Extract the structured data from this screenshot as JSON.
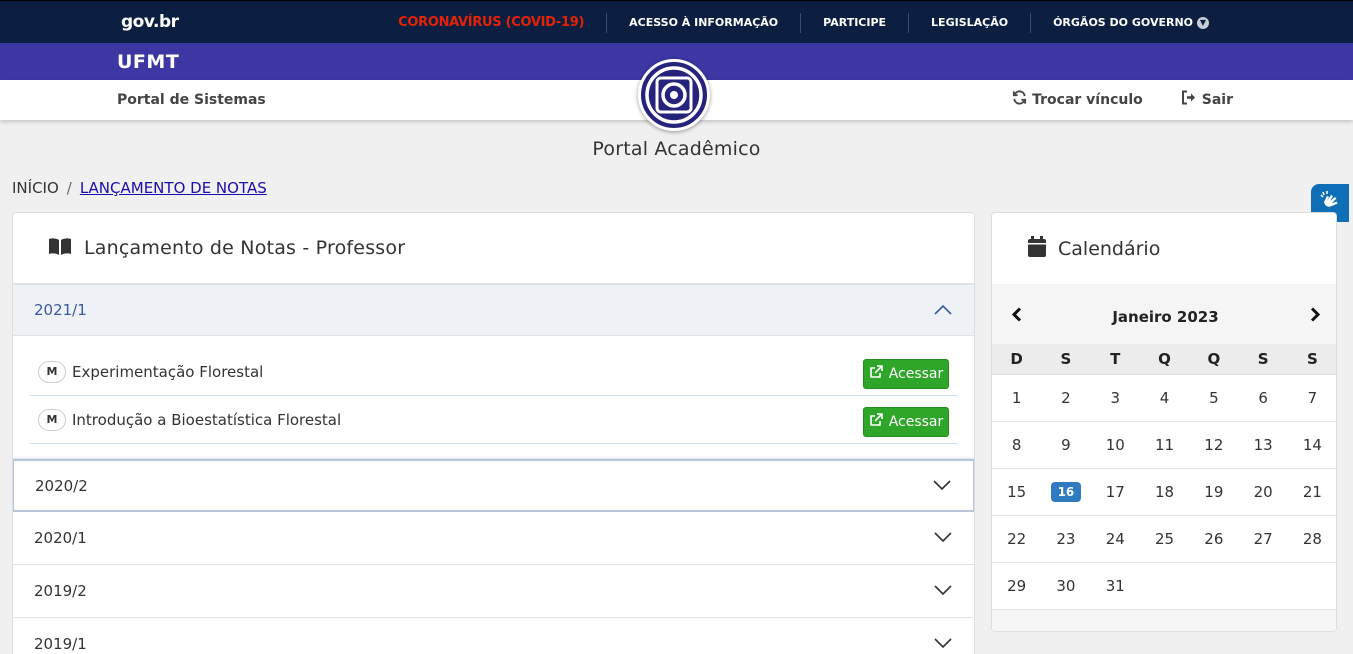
{
  "govbar": {
    "logo": "gov.br",
    "links": [
      {
        "label": "CORONAVÍRUS (COVID-19)"
      },
      {
        "label": "ACESSO À INFORMAÇÃO"
      },
      {
        "label": "PARTICIPE"
      },
      {
        "label": "LEGISLAÇÃO"
      },
      {
        "label": "ÓRGÃOS DO GOVERNO"
      }
    ]
  },
  "ufmtbar": {
    "title": "UFMT"
  },
  "sysbar": {
    "portal_sistemas": "Portal de Sistemas",
    "trocar_vinculo": "Trocar vínculo",
    "sair": "Sair"
  },
  "page_title": "Portal Acadêmico",
  "breadcrumb": {
    "home": "INÍCIO",
    "separator": "/",
    "current": "LANÇAMENTO DE NOTAS"
  },
  "main_card": {
    "title": "Lançamento de Notas - Professor",
    "periods": [
      {
        "label": "2021/1",
        "expanded": true,
        "courses": [
          {
            "badge": "M",
            "name": "Experimentação Florestal",
            "button": "Acessar"
          },
          {
            "badge": "M",
            "name": "Introdução a Bioestatística Florestal",
            "button": "Acessar"
          }
        ]
      },
      {
        "label": "2020/2",
        "expanded": false
      },
      {
        "label": "2020/1",
        "expanded": false
      },
      {
        "label": "2019/2",
        "expanded": false
      },
      {
        "label": "2019/1",
        "expanded": false
      }
    ]
  },
  "calendar": {
    "title": "Calendário",
    "month": "Janeiro 2023",
    "weekdays": [
      "D",
      "S",
      "T",
      "Q",
      "Q",
      "S",
      "S"
    ],
    "weeks": [
      [
        "1",
        "2",
        "3",
        "4",
        "5",
        "6",
        "7"
      ],
      [
        "8",
        "9",
        "10",
        "11",
        "12",
        "13",
        "14"
      ],
      [
        "15",
        "16",
        "17",
        "18",
        "19",
        "20",
        "21"
      ],
      [
        "22",
        "23",
        "24",
        "25",
        "26",
        "27",
        "28"
      ],
      [
        "29",
        "30",
        "31",
        "",
        "",
        "",
        ""
      ]
    ],
    "today": "16"
  },
  "colors": {
    "govbar_bg": "#0c1f40",
    "covid_red": "#e52207",
    "ufmt_purple": "#3c37a3",
    "acessar_green": "#2ea62a",
    "today_blue": "#2f7bbf"
  }
}
